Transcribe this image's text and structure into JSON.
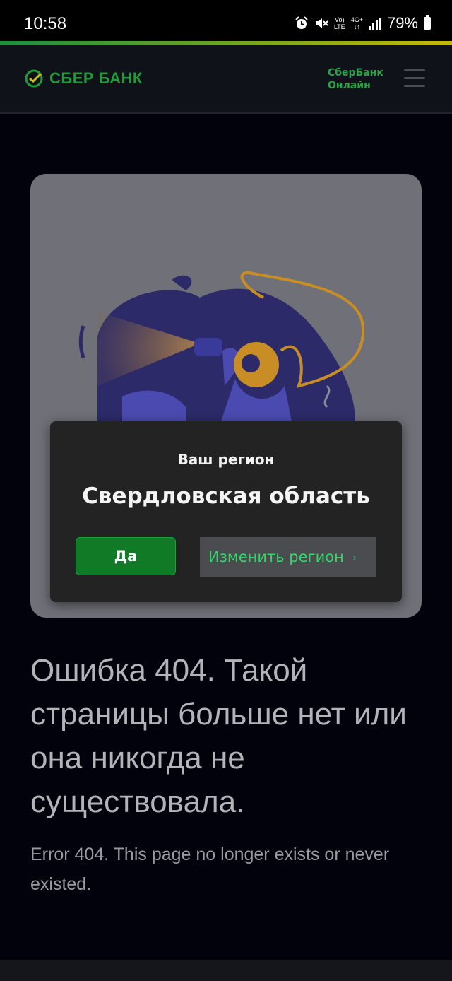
{
  "status_bar": {
    "time": "10:58",
    "network_top": "Vo)",
    "network_bottom": "LTE",
    "net4g_top": "4G+",
    "net4g_bottom": "↓↑",
    "battery": "79%",
    "icons": [
      "alarm-icon",
      "mute-icon",
      "signal-icon",
      "battery-icon"
    ]
  },
  "header": {
    "logo_text": "СБЕР БАНК",
    "online_line1": "СберБанк",
    "online_line2": "Онлайн",
    "brand_color": "#1f9b3a"
  },
  "region_dialog": {
    "subtitle": "Ваш регион",
    "region": "Свердловская область",
    "confirm_label": "Да",
    "change_label": "Изменить регион"
  },
  "error": {
    "title": "Ошибка 404. Такой страницы больше нет или она никогда не существовала.",
    "subtitle": "Error 404. This page no longer exists or never existed."
  }
}
